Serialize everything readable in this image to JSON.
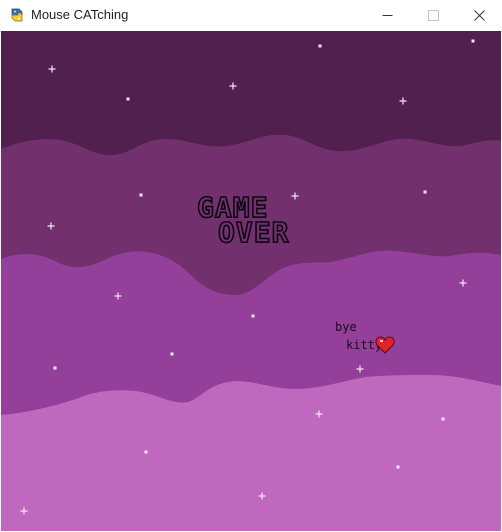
{
  "window": {
    "title": "Mouse CATching",
    "app_icon": "python-icon",
    "controls": [
      "minimize-icon",
      "maximize-icon",
      "close-icon"
    ]
  },
  "game": {
    "headline_line1": "GAME",
    "headline_line2": "OVER",
    "farewell_line1": "bye",
    "farewell_line2": "kitty",
    "farewell_icon": "heart-icon"
  },
  "colors": {
    "sky_top": "#51204f",
    "wave_band_1": "#72306f",
    "wave_band_2": "#94409a",
    "wave_band_3": "#c068be",
    "star": "#f4e8f4",
    "headline_outline": "#0b0810",
    "heart": "#e0242e"
  }
}
